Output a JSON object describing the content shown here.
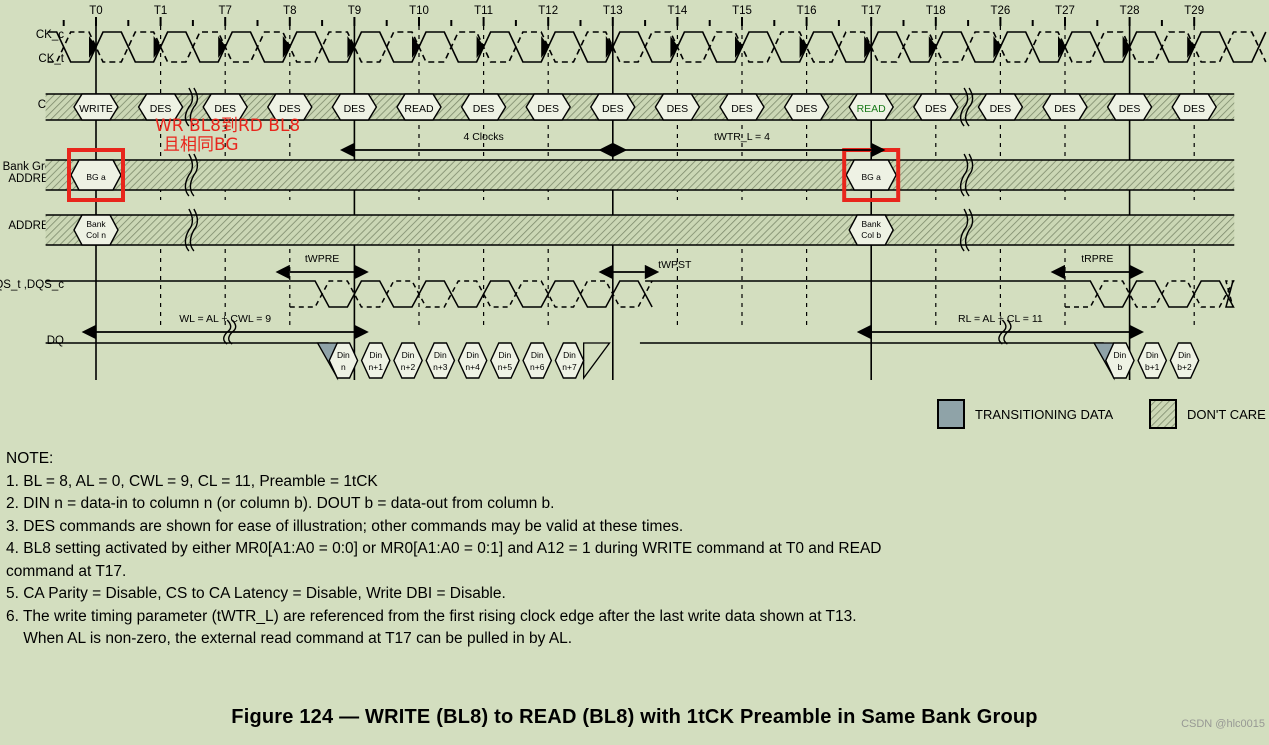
{
  "figure": {
    "caption": "Figure 124 — WRITE (BL8) to READ (BL8) with 1tCK Preamble in Same Bank Group",
    "watermark": "CSDN @hlc0015",
    "background_color": "#d3debf",
    "annotation_color": "#e8261c",
    "read_highlight_color": "#1a7a1a",
    "transitioning_fill": "#8fa3a8"
  },
  "time_labels": [
    "T0",
    "T1",
    "T7",
    "T8",
    "T9",
    "T10",
    "T11",
    "T12",
    "T13",
    "T14",
    "T15",
    "T16",
    "T17",
    "T18",
    "T26",
    "T27",
    "T28",
    "T29"
  ],
  "signal_labels": {
    "ck_c": "CK_c",
    "ck_t": "CK_t",
    "cmd": "CMD",
    "bank_group_1": "Bank Group",
    "bank_group_2": "ADDRESS",
    "address": "ADDRESS",
    "dqs": "DQS_t ,DQS_c",
    "dq": "DQ"
  },
  "cmd_row": [
    {
      "label": "WRITE",
      "at": "T0",
      "highlight": false
    },
    {
      "label": "DES",
      "at": "T1",
      "highlight": false
    },
    {
      "label": "DES",
      "at": "T7",
      "highlight": false
    },
    {
      "label": "DES",
      "at": "T8",
      "highlight": false
    },
    {
      "label": "DES",
      "at": "T9",
      "highlight": false
    },
    {
      "label": "READ",
      "at": "T10",
      "highlight": false
    },
    {
      "label": "DES",
      "at": "T11",
      "highlight": false
    },
    {
      "label": "DES",
      "at": "T12",
      "highlight": false
    },
    {
      "label": "DES",
      "at": "T13",
      "highlight": false
    },
    {
      "label": "DES",
      "at": "T14",
      "highlight": false
    },
    {
      "label": "DES",
      "at": "T15",
      "highlight": false
    },
    {
      "label": "DES",
      "at": "T16",
      "highlight": false
    },
    {
      "label": "READ",
      "at": "T17",
      "highlight": true
    },
    {
      "label": "DES",
      "at": "T18",
      "highlight": false
    },
    {
      "label": "DES",
      "at": "T26",
      "highlight": false
    },
    {
      "label": "DES",
      "at": "T27",
      "highlight": false
    },
    {
      "label": "DES",
      "at": "T28",
      "highlight": false
    },
    {
      "label": "DES",
      "at": "T29",
      "highlight": false
    }
  ],
  "bank_group_cells": [
    {
      "label": "BG  a",
      "at": "T0",
      "boxed": true
    },
    {
      "label": "BG  a",
      "at": "T17",
      "boxed": true
    }
  ],
  "address_cells": [
    {
      "line1": "Bank",
      "line2": "Col n",
      "at": "T0"
    },
    {
      "line1": "Bank",
      "line2": "Col b",
      "at": "T17"
    }
  ],
  "annotations": {
    "red_cn_line1": "WR  BL8到RD  BL8",
    "red_cn_line2": "且相同BG"
  },
  "timing_markers": [
    {
      "name": "4 Clocks",
      "from": "T9",
      "to": "T13"
    },
    {
      "name": "tWTR_L = 4",
      "from": "T13",
      "to": "T17"
    },
    {
      "name": "tWPRE",
      "from": "T8",
      "to": "T9"
    },
    {
      "name": "tWPST",
      "from": "T13",
      "to": "T13.5"
    },
    {
      "name": "tRPRE",
      "from": "T27",
      "to": "T28"
    },
    {
      "name": "WL = AL + CWL = 9",
      "from": "T0",
      "to": "T9"
    },
    {
      "name": "RL = AL + CL = 11",
      "from": "T17",
      "to": "T28"
    }
  ],
  "dq_write_burst": [
    "Din\nn",
    "Din\nn+1",
    "Din\nn+2",
    "Din\nn+3",
    "Din\nn+4",
    "Din\nn+5",
    "Din\nn+6",
    "Din\nn+7"
  ],
  "dq_write_burst_l1": [
    "Din",
    "Din",
    "Din",
    "Din",
    "Din",
    "Din",
    "Din",
    "Din"
  ],
  "dq_write_burst_l2": [
    "n",
    "n+1",
    "n+2",
    "n+3",
    "n+4",
    "n+5",
    "n+6",
    "n+7"
  ],
  "dq_read_burst_l1": [
    "Din",
    "Din",
    "Din"
  ],
  "dq_read_burst_l2": [
    "b",
    "b+1",
    "b+2"
  ],
  "legend": [
    {
      "label": "TRANSITIONING DATA",
      "swatch": "transitioning"
    },
    {
      "label": "DON'T CARE",
      "swatch": "dontcare"
    }
  ],
  "notes": {
    "header": "NOTE:",
    "items": [
      "1. BL = 8, AL = 0, CWL = 9, CL = 11, Preamble = 1tCK",
      "2. DIN n = data-in to column n (or column b). DOUT b = data-out from column b.",
      "3. DES commands are shown for ease of illustration; other commands may be valid at these times.",
      "4. BL8 setting activated by either MR0[A1:A0 = 0:0] or MR0[A1:A0 = 0:1] and A12 = 1 during WRITE command at T0 and READ",
      "command at T17.",
      "5. CA Parity = Disable, CS to CA Latency = Disable, Write DBI = Disable.",
      "6. The write timing parameter (tWTR_L) are referenced from the first rising clock edge after the last write data shown at T13.",
      "    When AL is non-zero, the external read command at T17 can be pulled in by AL."
    ]
  }
}
